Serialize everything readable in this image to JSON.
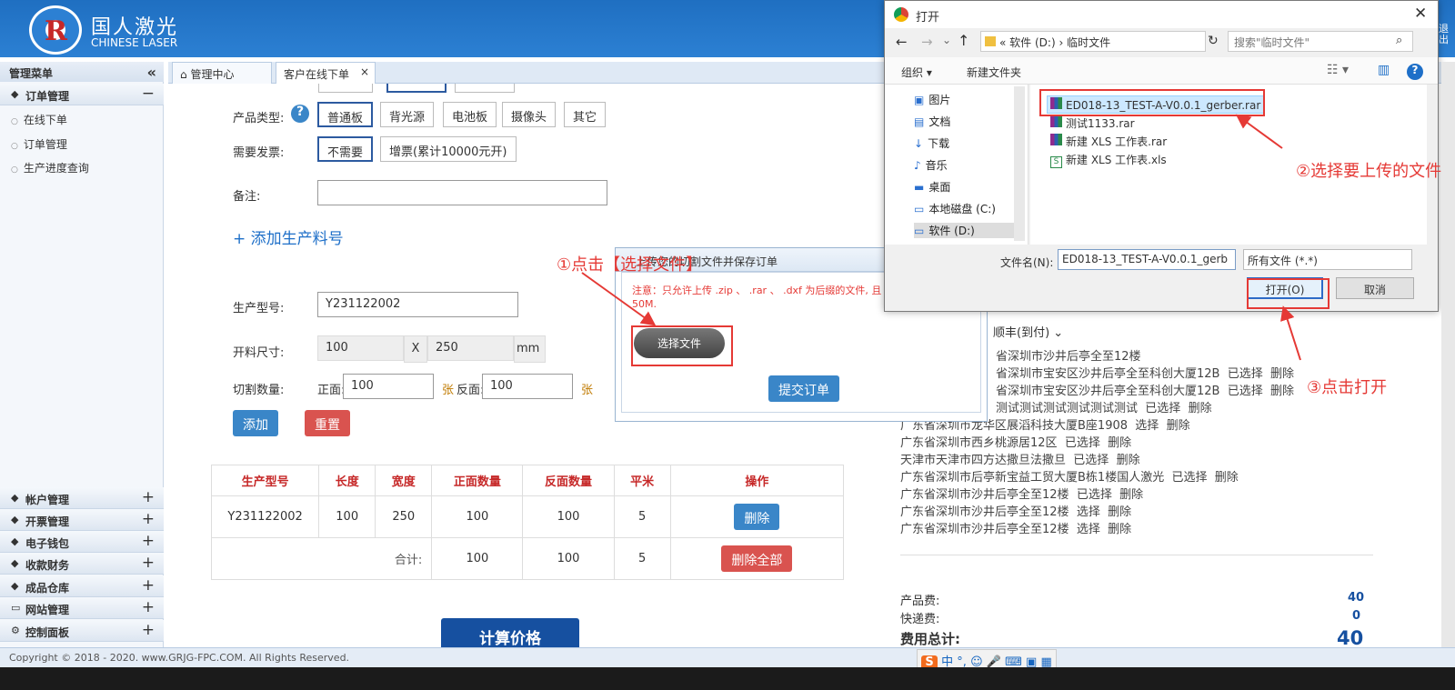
{
  "header": {
    "logo_mark": "R",
    "logo_cn": "国人激光",
    "logo_en": "CHINESE LASER",
    "right_hint": "退出"
  },
  "sidebar": {
    "title": "管理菜单",
    "collapse": "«",
    "sections": [
      {
        "label": "订单管理",
        "toggle": "−",
        "items": [
          "在线下单",
          "订单管理",
          "生产进度查询"
        ]
      },
      {
        "label": "帐户管理",
        "toggle": "+"
      },
      {
        "label": "开票管理",
        "toggle": "+"
      },
      {
        "label": "电子钱包",
        "toggle": "+"
      },
      {
        "label": "收款财务",
        "toggle": "+"
      },
      {
        "label": "成品仓库",
        "toggle": "+"
      },
      {
        "label": "网站管理",
        "toggle": "+"
      },
      {
        "label": "控制面板",
        "toggle": "+"
      }
    ]
  },
  "tabs": {
    "home": "管理中心",
    "active": "客户在线下单",
    "close": "×"
  },
  "form": {
    "row0_partial": [
      "口已",
      "口已",
      "口已"
    ],
    "product_type_label": "产品类型:",
    "help": "?",
    "product_types": [
      "普通板",
      "背光源",
      "电池板",
      "摄像头",
      "其它"
    ],
    "invoice_label": "需要发票:",
    "invoice_options": [
      "不需要",
      "增票(累计10000元开)"
    ],
    "remark_label": "备注:",
    "remark_value": "",
    "add_material": "+ 添加生产料号",
    "model_label": "生产型号:",
    "model_value": "Y231122002",
    "size_label": "开料尺寸:",
    "size_w": "100",
    "size_x": "X",
    "size_h": "250",
    "size_unit": "mm",
    "cut_label": "切割数量:",
    "front_label": "正面:",
    "front_value": "100",
    "unit1": "张",
    "back_label": "反面:",
    "back_value": "100",
    "unit2": "张",
    "add_btn": "添加",
    "reset_btn": "重置"
  },
  "table": {
    "headers": [
      "生产型号",
      "长度",
      "宽度",
      "正面数量",
      "反面数量",
      "平米",
      "操作"
    ],
    "rows": [
      [
        "Y231122002",
        "100",
        "250",
        "100",
        "100",
        "5"
      ]
    ],
    "delete_btn": "删除",
    "total_label": "合计:",
    "total": [
      "100",
      "100",
      "5"
    ],
    "delete_all_btn": "删除全部"
  },
  "calc_btn": "计算价格",
  "popup": {
    "title": "上传您的切割文件并保存订单",
    "notice": "注意：只允许上传 .zip 、 .rar 、 .dxf 为后缀的文件, 且",
    "notice2": "50M.",
    "choose_btn": "选择文件",
    "submit_btn": "提交订单"
  },
  "right": {
    "shipping": "顺丰(到付)",
    "addresses": [
      {
        "text": "省深圳市沙井后亭全至12楼",
        "actions": []
      },
      {
        "text": "省深圳市宝安区沙井后亭全至科创大厦12B",
        "actions": [
          "已选择",
          "删除"
        ]
      },
      {
        "text": "省深圳市宝安区沙井后亭全至科创大厦12B",
        "actions": [
          "已选择",
          "删除"
        ]
      },
      {
        "text": "测试测试测试测试测试测试",
        "actions": [
          "已选择",
          "删除"
        ]
      },
      {
        "text": "广东省深圳市龙华区展滔科技大厦B座1908",
        "actions": [
          "选择",
          "删除"
        ]
      },
      {
        "text": "广东省深圳市西乡桃源居12区",
        "actions": [
          "已选择",
          "删除"
        ]
      },
      {
        "text": "天津市天津市四方达撒旦法撒旦",
        "actions": [
          "已选择",
          "删除"
        ]
      },
      {
        "text": "广东省深圳市后亭新宝益工贸大厦B栋1楼国人激光",
        "actions": [
          "已选择",
          "删除"
        ]
      },
      {
        "text": "广东省深圳市沙井后亭全至12楼",
        "actions": [
          "已选择",
          "删除"
        ]
      },
      {
        "text": "广东省深圳市沙井后亭全至12楼",
        "actions": [
          "选择",
          "删除"
        ]
      },
      {
        "text": "广东省深圳市沙井后亭全至12楼",
        "actions": [
          "选择",
          "删除"
        ]
      }
    ],
    "product_fee_label": "产品费:",
    "product_fee": "40",
    "express_label": "快递费:",
    "express": "0",
    "total_label": "费用总计:",
    "total": "40"
  },
  "footer": "Copyright © 2018 - 2020. www.GRJG-FPC.COM. All Rights Reserved.",
  "ime": {
    "logo": "S",
    "lang": "中",
    "punct": "°,"
  },
  "dialog": {
    "title": "打开",
    "close": "✕",
    "path": [
      "«",
      "软件 (D:)",
      "›",
      "临时文件"
    ],
    "search_placeholder": "搜索\"临时文件\"",
    "organize": "组织 ▾",
    "new_folder": "新建文件夹",
    "nav": [
      "图片",
      "文档",
      "下载",
      "音乐",
      "桌面",
      "本地磁盘 (C:)",
      "软件 (D:)"
    ],
    "files": [
      "ED018-13_TEST-A-V0.0.1_gerber.rar",
      "测试1133.rar",
      "新建 XLS 工作表.rar",
      "新建 XLS 工作表.xls"
    ],
    "filename_label": "文件名(N):",
    "filename_value": "ED018-13_TEST-A-V0.0.1_gerb",
    "filetype": "所有文件 (*.*)",
    "open_btn": "打开(O)",
    "cancel_btn": "取消"
  },
  "annotations": {
    "step1": "①点击【选择文件】",
    "step2": "②选择要上传的文件",
    "step3": "③点击打开"
  },
  "colors": {
    "header": "#2c80d3",
    "red": "#e53935",
    "blue_btn": "#3a86c8",
    "danger_btn": "#d9534f",
    "calc_btn": "#1650a0"
  }
}
